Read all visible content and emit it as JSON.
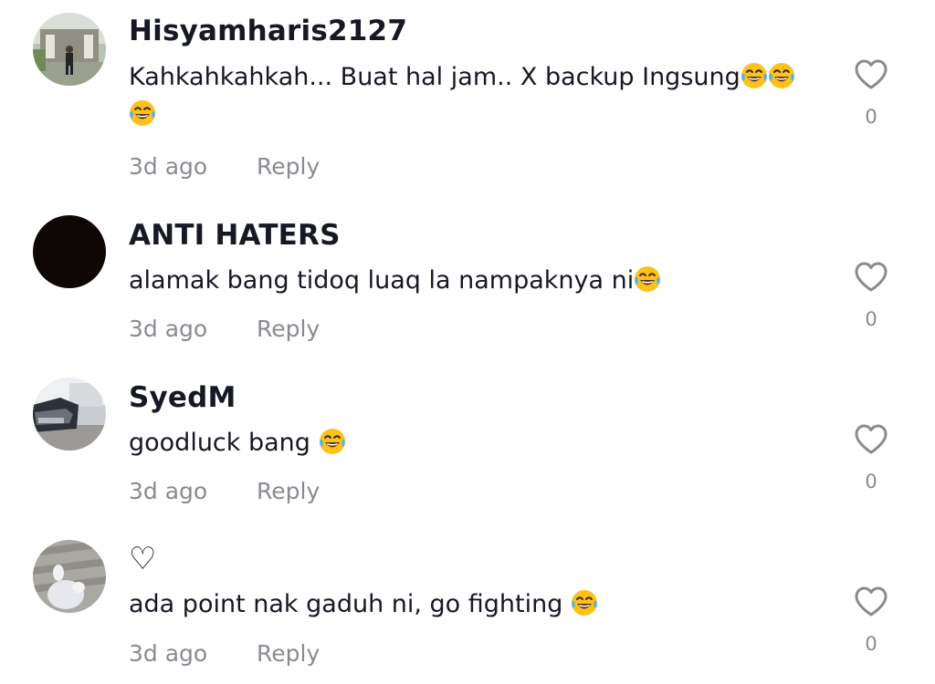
{
  "comments": [
    {
      "username": "Hisyamharis2127",
      "text_line1": "Kahkahkahkah... Buat hal jam.. X backup Ingsung",
      "time": "3d ago",
      "reply_label": "Reply",
      "like_count": "0"
    },
    {
      "username": "ANTI HATERS",
      "text": "alamak bang tidoq luaq la nampaknya ni",
      "time": "3d ago",
      "reply_label": "Reply",
      "like_count": "0"
    },
    {
      "username": "SyedM",
      "text": "goodluck bang ",
      "time": "3d ago",
      "reply_label": "Reply",
      "like_count": "0"
    },
    {
      "username": "♡",
      "text": "ada point nak gaduh ni, go fighting ",
      "time": "3d ago",
      "reply_label": "Reply",
      "like_count": "0"
    }
  ],
  "icons": {
    "like": "heart-outline-icon",
    "emoji": "face-with-tears-of-joy-emoji"
  },
  "colors": {
    "text_primary": "#161823",
    "text_secondary": "#8a8b91",
    "emoji_yellow": "#fcc21b"
  }
}
